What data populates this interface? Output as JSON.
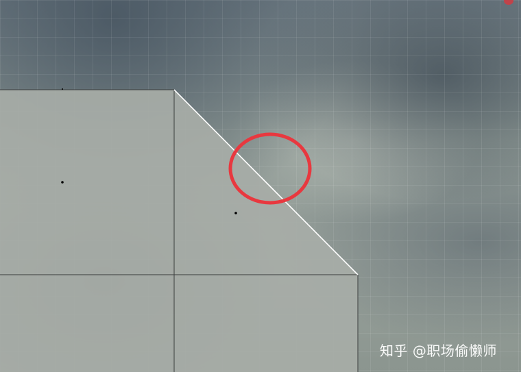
{
  "watermark": {
    "text": "知乎 @职场偷懒师"
  },
  "colors": {
    "highlight_circle": "#e8383f",
    "edge_line": "#ffffff",
    "shape_fill": "#a7aca7",
    "outline": "#3a3d3d"
  },
  "icons": {
    "rec": "red-dot-icon"
  }
}
